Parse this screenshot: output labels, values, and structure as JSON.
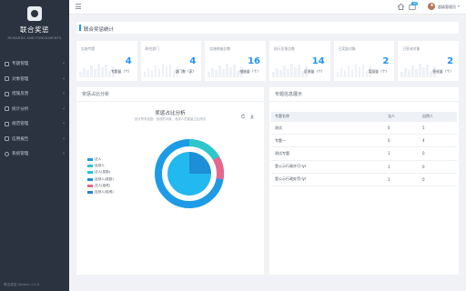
{
  "sidebar": {
    "brand": "联合奖惩",
    "brand_en": "REWARDS AND PUNISHMENTS",
    "items": [
      {
        "label": "专题管理",
        "icon": "list-icon"
      },
      {
        "label": "对象管理",
        "icon": "user-icon"
      },
      {
        "label": "措施反馈",
        "icon": "feedback-icon"
      },
      {
        "label": "统计分析",
        "icon": "chart-icon"
      },
      {
        "label": "规范管理",
        "icon": "doc-icon"
      },
      {
        "label": "信用报告",
        "icon": "report-icon"
      },
      {
        "label": "系统管理",
        "icon": "settings-icon"
      }
    ],
    "version": "联合奖惩 Version 1.0.0"
  },
  "header": {
    "notification_count": "30",
    "user_name": "超级管理员"
  },
  "main": {
    "section_title": "联合奖惩统计",
    "cards": [
      {
        "label": "实施专题",
        "value": "4",
        "unit": "专题量（个）"
      },
      {
        "label": "联合部门",
        "value": "4",
        "unit": "部门数（家）"
      },
      {
        "label": "实施措施总数",
        "value": "16",
        "unit": "措施量（个）"
      },
      {
        "label": "执行反馈总数",
        "value": "14",
        "unit": "反馈量（个）"
      },
      {
        "label": "已奖励对象",
        "value": "2",
        "unit": "奖励量（个）"
      },
      {
        "label": "已惩戒对象",
        "value": "2",
        "unit": "惩戒量（个）"
      }
    ],
    "left_panel": {
      "title": "奖惩占比分析",
      "chart_title": "奖惩占比分析",
      "chart_subtitle": "统计所有激励、惩戒的对象、各类人员数量占比情况",
      "legend": [
        {
          "label": "法人",
          "color": "#1e9be6"
        },
        {
          "label": "自然人",
          "color": "#2ec7c9"
        },
        {
          "label": "法人(奖励)",
          "color": "#21c4e0"
        },
        {
          "label": "自然人(奖励)",
          "color": "#1c8fd6"
        },
        {
          "label": "法人(惩戒)",
          "color": "#e8668d"
        },
        {
          "label": "自然人(惩戒)",
          "color": "#2a7fd1"
        }
      ]
    },
    "right_panel": {
      "title": "专题信息展示",
      "columns": [
        "专题名称",
        "法人",
        "自然人"
      ],
      "rows": [
        [
          "测试",
          "0",
          "1"
        ],
        [
          "专题一",
          "0",
          "4"
        ],
        [
          "测试专题",
          "1",
          "0"
        ],
        [
          "登公示行政许可-lyr",
          "1",
          "0"
        ],
        [
          "登公示行政处罚-lyr",
          "1",
          "0"
        ]
      ]
    }
  }
}
